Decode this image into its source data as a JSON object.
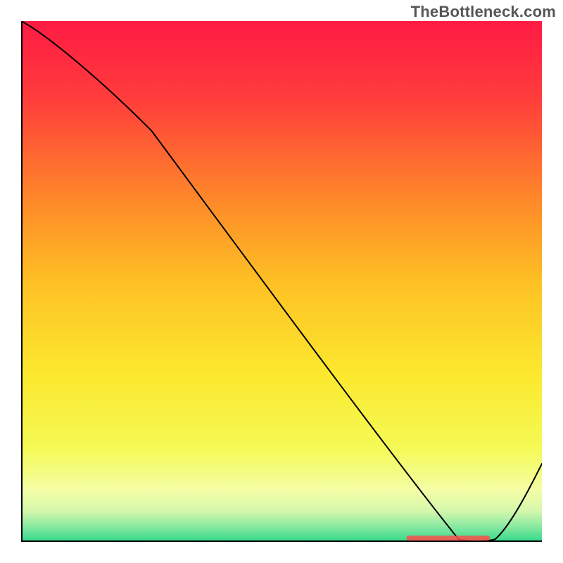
{
  "watermark": "TheBottleneck.com",
  "chart_data": {
    "type": "line",
    "title": "",
    "xlabel": "",
    "ylabel": "",
    "xlim": [
      0,
      100
    ],
    "ylim": [
      0,
      100
    ],
    "grid": false,
    "legend": false,
    "series": [
      {
        "name": "curve",
        "x": [
          0,
          8,
          25,
          84,
          91,
          100
        ],
        "y": [
          100,
          94,
          79,
          0.5,
          0.5,
          15
        ]
      }
    ],
    "background_gradient": {
      "type": "vertical",
      "stops": [
        {
          "offset": 0.0,
          "color": "#ff1b44"
        },
        {
          "offset": 0.15,
          "color": "#ff3d3b"
        },
        {
          "offset": 0.35,
          "color": "#fe8b29"
        },
        {
          "offset": 0.5,
          "color": "#fec024"
        },
        {
          "offset": 0.68,
          "color": "#fbe92e"
        },
        {
          "offset": 0.82,
          "color": "#f5fa56"
        },
        {
          "offset": 0.9,
          "color": "#f4fda5"
        },
        {
          "offset": 0.94,
          "color": "#d6f8ad"
        },
        {
          "offset": 0.97,
          "color": "#8be9a1"
        },
        {
          "offset": 1.0,
          "color": "#2fd98b"
        }
      ]
    },
    "marker_band": {
      "x_start": 74,
      "x_end": 90,
      "y": 0.8,
      "color": "#ff4b4b"
    },
    "axis_color": "#000000",
    "line_color": "#000000",
    "line_width": 2
  }
}
